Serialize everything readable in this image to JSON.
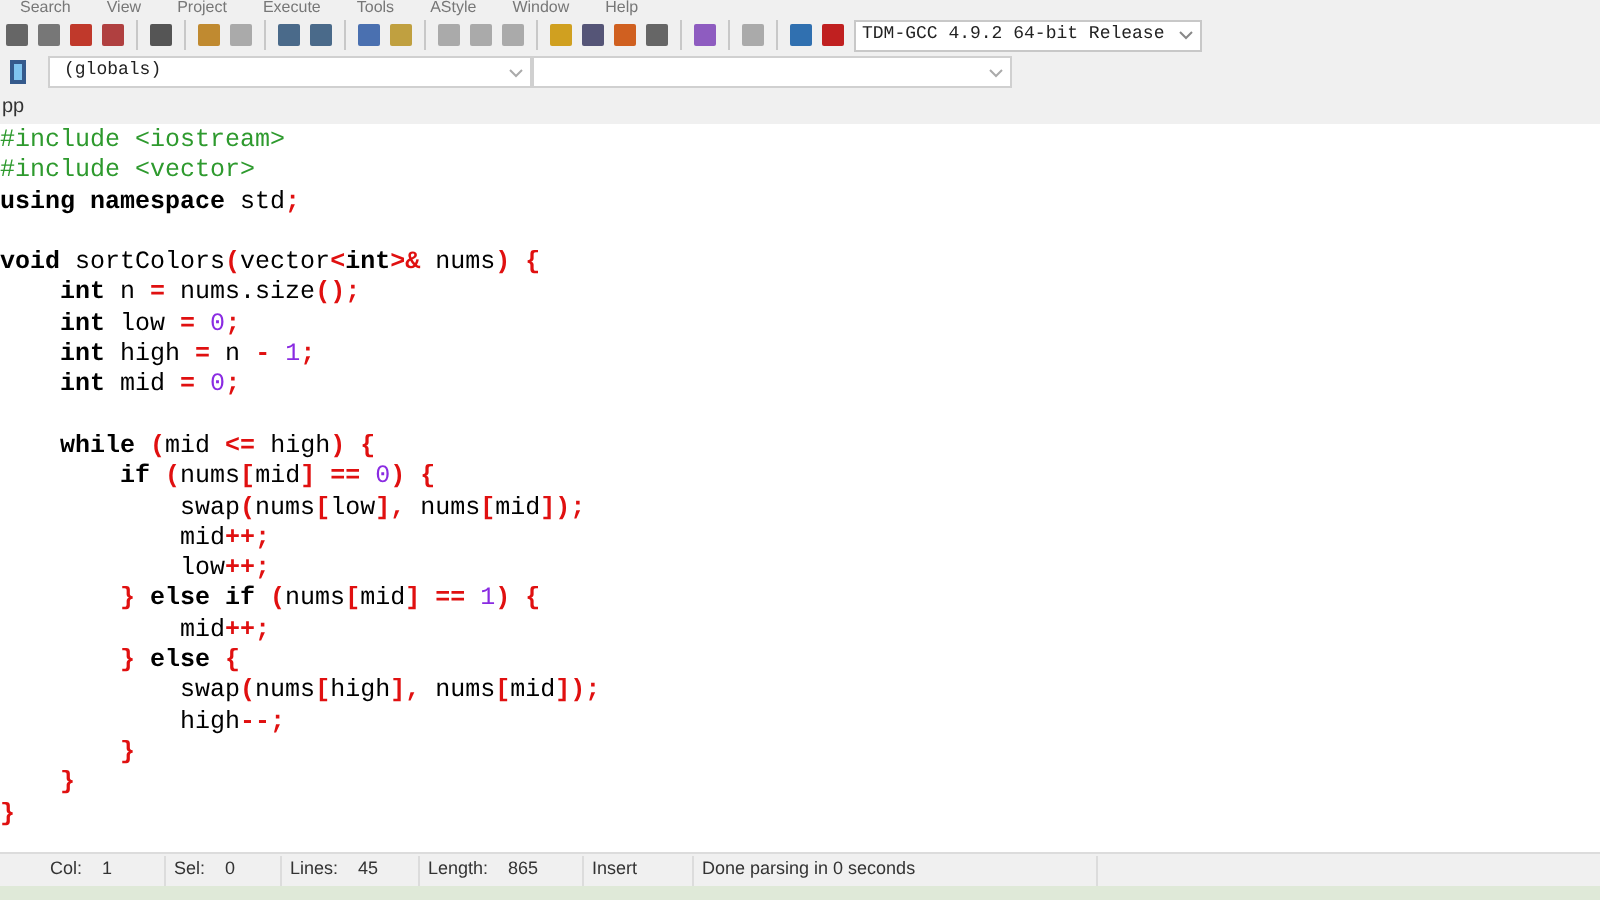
{
  "menu": [
    "Search",
    "View",
    "Project",
    "Execute",
    "Tools",
    "AStyle",
    "Window",
    "Help"
  ],
  "compiler_select": {
    "value": "TDM-GCC 4.9.2 64-bit Release"
  },
  "scope_select": {
    "value": "(globals)"
  },
  "file_tab": {
    "label": "pp"
  },
  "editor": {
    "lines": [
      {
        "kind": "code",
        "tokens": [
          {
            "kind": "preproc",
            "text": "#include <iostream>"
          }
        ]
      },
      {
        "kind": "code",
        "tokens": [
          {
            "kind": "preproc",
            "text": "#include <vector>"
          }
        ]
      },
      {
        "kind": "code",
        "tokens": [
          {
            "kind": "keyword",
            "text": "using namespace"
          },
          {
            "kind": "plain",
            "text": " std"
          },
          {
            "kind": "symbol",
            "text": ";"
          }
        ]
      },
      {
        "kind": "blank"
      },
      {
        "kind": "code",
        "tokens": [
          {
            "kind": "keyword",
            "text": "void"
          },
          {
            "kind": "plain",
            "text": " sortColors"
          },
          {
            "kind": "symbol",
            "text": "("
          },
          {
            "kind": "plain",
            "text": "vector"
          },
          {
            "kind": "symbol",
            "text": "<"
          },
          {
            "kind": "keyword",
            "text": "int"
          },
          {
            "kind": "symbol",
            "text": ">&"
          },
          {
            "kind": "plain",
            "text": " nums"
          },
          {
            "kind": "symbol",
            "text": ")"
          },
          {
            "kind": "symbol",
            "text": " {"
          }
        ]
      },
      {
        "kind": "code",
        "tokens": [
          {
            "kind": "keyword",
            "text": "    int"
          },
          {
            "kind": "plain",
            "text": " n "
          },
          {
            "kind": "symbol",
            "text": "="
          },
          {
            "kind": "plain",
            "text": " nums.size"
          },
          {
            "kind": "symbol",
            "text": "();"
          }
        ]
      },
      {
        "kind": "code",
        "tokens": [
          {
            "kind": "keyword",
            "text": "    int"
          },
          {
            "kind": "plain",
            "text": " low "
          },
          {
            "kind": "symbol",
            "text": "="
          },
          {
            "kind": "number",
            "text": " 0"
          },
          {
            "kind": "symbol",
            "text": ";"
          }
        ]
      },
      {
        "kind": "code",
        "tokens": [
          {
            "kind": "keyword",
            "text": "    int"
          },
          {
            "kind": "plain",
            "text": " high "
          },
          {
            "kind": "symbol",
            "text": "="
          },
          {
            "kind": "plain",
            "text": " n "
          },
          {
            "kind": "symbol",
            "text": "-"
          },
          {
            "kind": "number",
            "text": " 1"
          },
          {
            "kind": "symbol",
            "text": ";"
          }
        ]
      },
      {
        "kind": "code",
        "tokens": [
          {
            "kind": "keyword",
            "text": "    int"
          },
          {
            "kind": "plain",
            "text": " mid "
          },
          {
            "kind": "symbol",
            "text": "="
          },
          {
            "kind": "number",
            "text": " 0"
          },
          {
            "kind": "symbol",
            "text": ";"
          }
        ]
      },
      {
        "kind": "blank"
      },
      {
        "kind": "code",
        "tokens": [
          {
            "kind": "keyword",
            "text": "    while"
          },
          {
            "kind": "symbol",
            "text": " ("
          },
          {
            "kind": "plain",
            "text": "mid "
          },
          {
            "kind": "symbol",
            "text": "<="
          },
          {
            "kind": "plain",
            "text": " high"
          },
          {
            "kind": "symbol",
            "text": ")"
          },
          {
            "kind": "symbol",
            "text": " {"
          }
        ]
      },
      {
        "kind": "code",
        "tokens": [
          {
            "kind": "keyword",
            "text": "        if"
          },
          {
            "kind": "symbol",
            "text": " ("
          },
          {
            "kind": "plain",
            "text": "nums"
          },
          {
            "kind": "symbol",
            "text": "["
          },
          {
            "kind": "plain",
            "text": "mid"
          },
          {
            "kind": "symbol",
            "text": "]"
          },
          {
            "kind": "symbol",
            "text": " =="
          },
          {
            "kind": "number",
            "text": " 0"
          },
          {
            "kind": "symbol",
            "text": ")"
          },
          {
            "kind": "symbol",
            "text": " {"
          }
        ]
      },
      {
        "kind": "code",
        "tokens": [
          {
            "kind": "plain",
            "text": "            swap"
          },
          {
            "kind": "symbol",
            "text": "("
          },
          {
            "kind": "plain",
            "text": "nums"
          },
          {
            "kind": "symbol",
            "text": "["
          },
          {
            "kind": "plain",
            "text": "low"
          },
          {
            "kind": "symbol",
            "text": "],"
          },
          {
            "kind": "plain",
            "text": " nums"
          },
          {
            "kind": "symbol",
            "text": "["
          },
          {
            "kind": "plain",
            "text": "mid"
          },
          {
            "kind": "symbol",
            "text": "]);"
          }
        ]
      },
      {
        "kind": "code",
        "tokens": [
          {
            "kind": "plain",
            "text": "            mid"
          },
          {
            "kind": "symbol",
            "text": "++;"
          }
        ]
      },
      {
        "kind": "code",
        "tokens": [
          {
            "kind": "plain",
            "text": "            low"
          },
          {
            "kind": "symbol",
            "text": "++;"
          }
        ]
      },
      {
        "kind": "code",
        "tokens": [
          {
            "kind": "symbol",
            "text": "        }"
          },
          {
            "kind": "keyword",
            "text": " else if"
          },
          {
            "kind": "symbol",
            "text": " ("
          },
          {
            "kind": "plain",
            "text": "nums"
          },
          {
            "kind": "symbol",
            "text": "["
          },
          {
            "kind": "plain",
            "text": "mid"
          },
          {
            "kind": "symbol",
            "text": "]"
          },
          {
            "kind": "symbol",
            "text": " =="
          },
          {
            "kind": "number",
            "text": " 1"
          },
          {
            "kind": "symbol",
            "text": ")"
          },
          {
            "kind": "symbol",
            "text": " {"
          }
        ]
      },
      {
        "kind": "code",
        "tokens": [
          {
            "kind": "plain",
            "text": "            mid"
          },
          {
            "kind": "symbol",
            "text": "++;"
          }
        ]
      },
      {
        "kind": "code",
        "tokens": [
          {
            "kind": "symbol",
            "text": "        }"
          },
          {
            "kind": "keyword",
            "text": " else"
          },
          {
            "kind": "symbol",
            "text": " {"
          }
        ]
      },
      {
        "kind": "code",
        "tokens": [
          {
            "kind": "plain",
            "text": "            swap"
          },
          {
            "kind": "symbol",
            "text": "("
          },
          {
            "kind": "plain",
            "text": "nums"
          },
          {
            "kind": "symbol",
            "text": "["
          },
          {
            "kind": "plain",
            "text": "high"
          },
          {
            "kind": "symbol",
            "text": "],"
          },
          {
            "kind": "plain",
            "text": " nums"
          },
          {
            "kind": "symbol",
            "text": "["
          },
          {
            "kind": "plain",
            "text": "mid"
          },
          {
            "kind": "symbol",
            "text": "]);"
          }
        ]
      },
      {
        "kind": "code",
        "tokens": [
          {
            "kind": "plain",
            "text": "            high"
          },
          {
            "kind": "symbol",
            "text": "--;"
          }
        ]
      },
      {
        "kind": "code",
        "tokens": [
          {
            "kind": "symbol",
            "text": "        }"
          }
        ]
      },
      {
        "kind": "code",
        "tokens": [
          {
            "kind": "symbol",
            "text": "    }"
          }
        ]
      },
      {
        "kind": "code",
        "tokens": [
          {
            "kind": "symbol",
            "text": "}"
          }
        ]
      }
    ]
  },
  "status_bar": [
    {
      "label": "Col:",
      "value": "1"
    },
    {
      "label": "Sel:",
      "value": "0"
    },
    {
      "label": "Lines:",
      "value": "45"
    },
    {
      "label": "Length:",
      "value": "865"
    },
    {
      "value": "Insert"
    },
    {
      "value": "Done parsing in 0 seconds"
    }
  ]
}
